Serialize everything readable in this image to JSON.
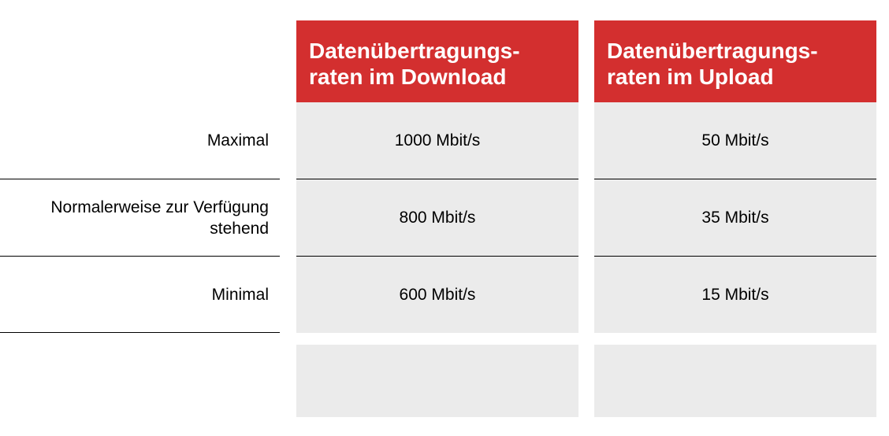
{
  "columns": [
    {
      "header": [
        "Datenübertragungs-",
        "raten im Download"
      ]
    },
    {
      "header": [
        "Datenübertragungs-",
        "raten im Upload"
      ]
    }
  ],
  "rows": [
    {
      "label": [
        "Maximal"
      ],
      "download": "1000 Mbit/s",
      "upload": "50 Mbit/s"
    },
    {
      "label": [
        "Normalerweise zur Verfügung",
        "stehend"
      ],
      "download": "800 Mbit/s",
      "upload": "35 Mbit/s"
    },
    {
      "label": [
        "Minimal"
      ],
      "download": "600 Mbit/s",
      "upload": "15 Mbit/s"
    }
  ],
  "colors": {
    "header_bg": "#d32f2f",
    "cell_bg": "#ebebeb",
    "divider": "#000000"
  }
}
